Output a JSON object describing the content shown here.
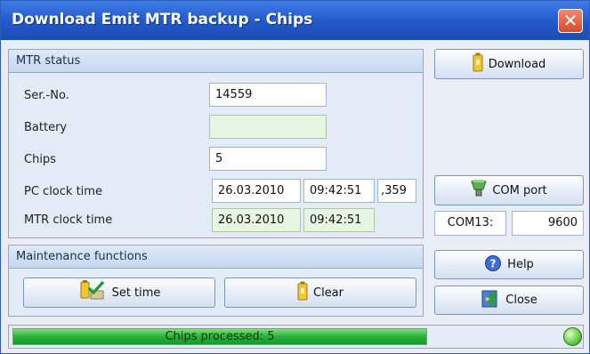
{
  "window": {
    "title": "Download Emit MTR backup - Chips",
    "close_glyph": "✕"
  },
  "mtr_status": {
    "header": "MTR status",
    "serial_label": "Ser.-No.",
    "serial_value": "14559",
    "battery_label": "Battery",
    "battery_value": "",
    "chips_label": "Chips",
    "chips_value": "5",
    "pc_clock_label": "PC clock time",
    "pc_date": "26.03.2010",
    "pc_time": "09:42:51",
    "pc_ms": ",359",
    "mtr_clock_label": "MTR clock time",
    "mtr_date": "26.03.2010",
    "mtr_time": "09:42:51"
  },
  "maintenance": {
    "header": "Maintenance functions",
    "set_time_label": "Set time",
    "clear_label": "Clear"
  },
  "side": {
    "download_label": "Download",
    "com_port_label": "COM port",
    "com_port_value": "COM13:",
    "baud_value": "9600",
    "help_label": "Help",
    "close_label": "Close"
  },
  "status": {
    "progress_text": "Chips processed:  5",
    "progress_fraction": 1.0
  },
  "icons": {
    "download": "battery-icon",
    "set_time": "battery-check-icon",
    "clear": "battery-icon",
    "com_port": "plug-icon",
    "help": "help-icon",
    "close": "exit-door-icon",
    "status": "status-led-icon"
  },
  "colors": {
    "title_bar": "#2358c9",
    "progress": "#28b13a",
    "readonly_field": "#e6f6e3"
  }
}
